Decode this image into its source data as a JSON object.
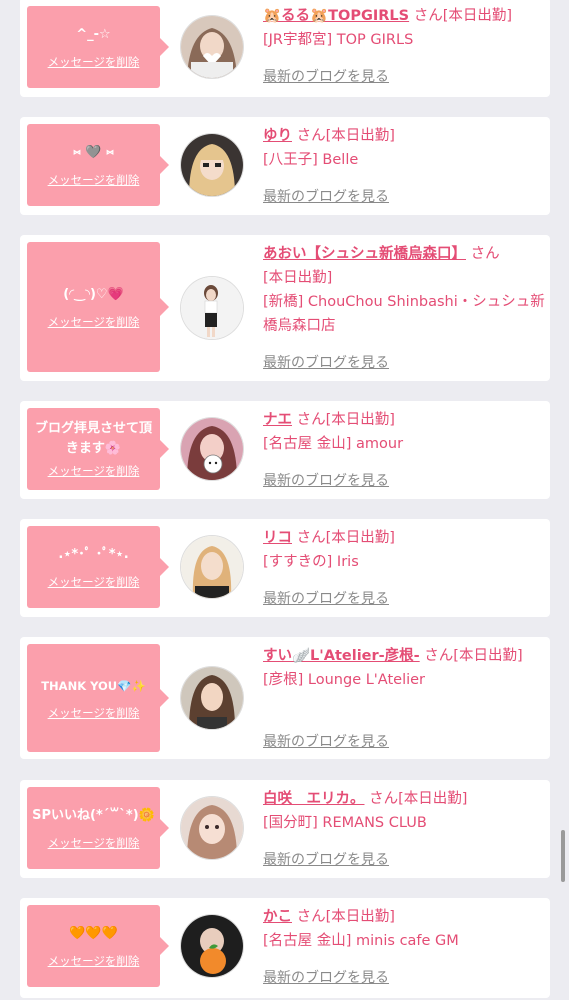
{
  "messages": [
    {
      "emote": "^_-☆",
      "delete_label": "メッセージを削除",
      "name": "🐹るる🐹TOPGIRLS",
      "san": "さん",
      "status": "[本日出勤]",
      "shop": "[JR宇都宮] TOP GIRLS",
      "blog_label": "最新のブログを見る"
    },
    {
      "emote": "⑅ 🩶 ⑅",
      "delete_label": "メッセージを削除",
      "name": "ゆり",
      "san": "さん",
      "status": "[本日出勤]",
      "shop": "[八王子] Belle",
      "blog_label": "最新のブログを見る"
    },
    {
      "emote": "(◜‿◝)♡💗",
      "delete_label": "メッセージを削除",
      "name": "あおい【シュシュ新橋烏森口】",
      "san": "さん",
      "status": "[本日出勤]",
      "shop": "[新橋] ChouChou Shinbashi・シュシュ新橋烏森口店",
      "blog_label": "最新のブログを見る"
    },
    {
      "emote": "ブログ拝見させて頂きます🌸",
      "delete_label": "メッセージを削除",
      "name": "ナエ",
      "san": "さん",
      "status": "[本日出勤]",
      "shop": "[名古屋 金山] amour",
      "blog_label": "最新のブログを見る"
    },
    {
      "emote": ".⋆*･ﾟ ･ﾟ*⋆.",
      "delete_label": "メッセージを削除",
      "name": "リコ",
      "san": "さん",
      "status": "[本日出勤]",
      "shop": "[すすきの] Iris",
      "blog_label": "最新のブログを見る"
    },
    {
      "emote": "THANK YOU💎✨",
      "delete_label": "メッセージを削除",
      "name": "すい🪽L'Atelier-彦根-",
      "san": "さん",
      "status": "[本日出勤]",
      "shop": "[彦根] Lounge L'Atelier",
      "blog_label": "最新のブログを見る"
    },
    {
      "emote": "SPいいね(*´꒳`*)🌼",
      "delete_label": "メッセージを削除",
      "name": "白咲　エリカ。",
      "san": "さん",
      "status": "[本日出勤]",
      "shop": "[国分町] REMANS CLUB",
      "blog_label": "最新のブログを見る"
    },
    {
      "emote": "🧡🧡🧡",
      "delete_label": "メッセージを削除",
      "name": "かこ",
      "san": "さん",
      "status": "[本日出勤]",
      "shop": "[名古屋 金山] minis cafe GM",
      "blog_label": "最新のブログを見る"
    }
  ],
  "colors": {
    "accent": "#e44d75",
    "bubble": "#fb9fac",
    "page_bg": "#ececf1",
    "muted": "#8a8a8a"
  },
  "icons": {
    "bubble_tail": "speech-bubble-pointer",
    "scrollbar": "vertical-scroll-thumb"
  }
}
